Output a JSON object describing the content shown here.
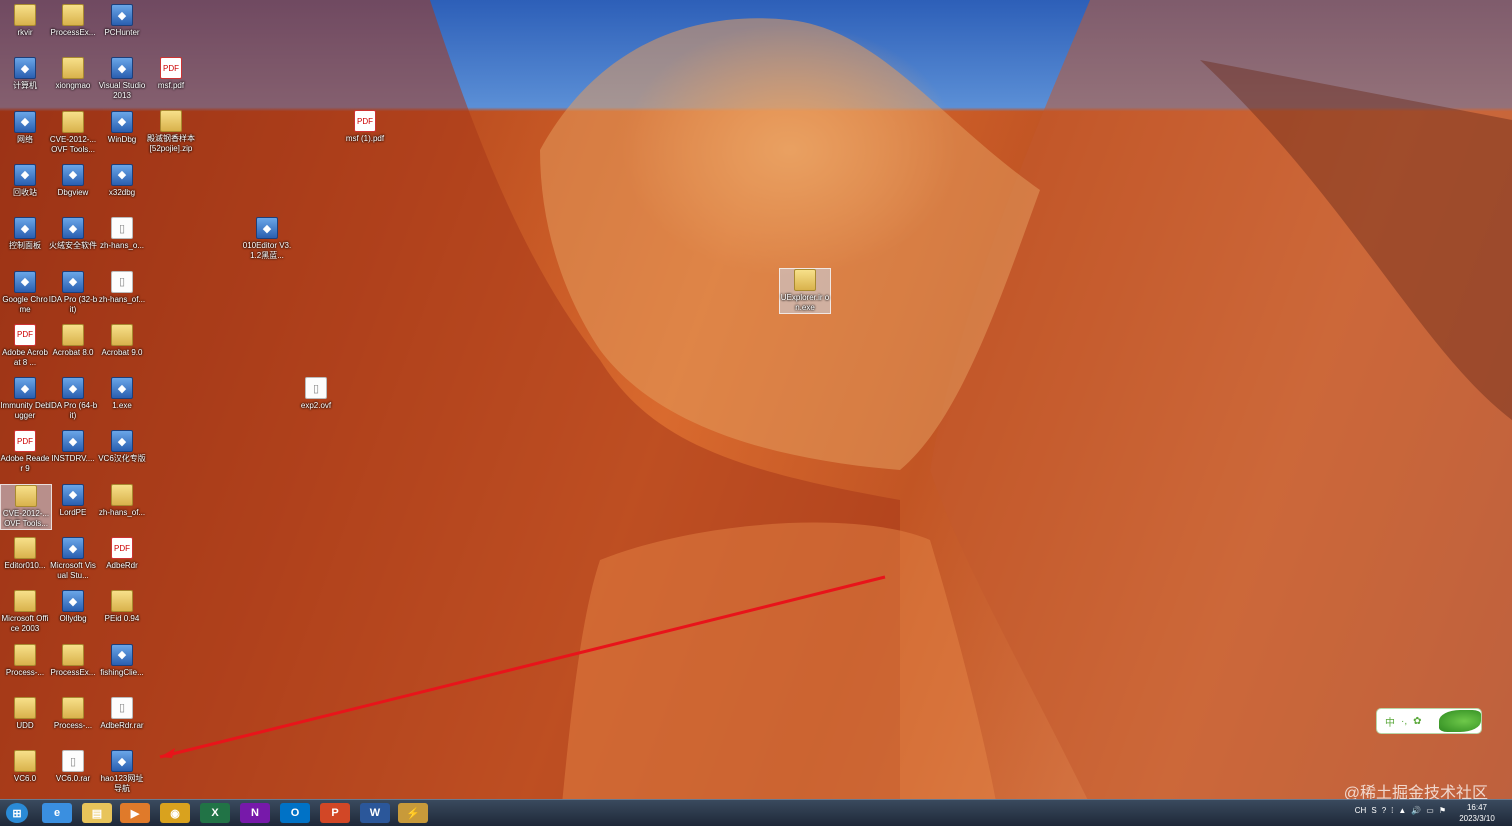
{
  "desktop": {
    "col1": [
      {
        "label": "rkvir",
        "kind": "folder"
      },
      {
        "label": "计算机",
        "kind": "app"
      },
      {
        "label": "网络",
        "kind": "app"
      },
      {
        "label": "回收站",
        "kind": "app"
      },
      {
        "label": "控制面板",
        "kind": "app"
      },
      {
        "label": "Google Chrome",
        "kind": "app"
      },
      {
        "label": "Adobe Acrobat 8 ...",
        "kind": "pdf"
      },
      {
        "label": "Immunity Debugger",
        "kind": "app"
      },
      {
        "label": "Adobe Reader 9",
        "kind": "pdf"
      },
      {
        "label": "CVE-2012-... OVF Tools...",
        "kind": "folder",
        "selected": true
      },
      {
        "label": "Editor010...",
        "kind": "folder"
      },
      {
        "label": "Microsoft Office 2003",
        "kind": "folder"
      },
      {
        "label": "Process-...",
        "kind": "folder"
      },
      {
        "label": "UDD",
        "kind": "folder"
      },
      {
        "label": "VC6.0",
        "kind": "folder"
      }
    ],
    "col2": [
      {
        "label": "ProcessEx...",
        "kind": "folder"
      },
      {
        "label": "xiongmao",
        "kind": "folder"
      },
      {
        "label": "CVE-2012-... OVF Tools...",
        "kind": "folder"
      },
      {
        "label": "Dbgview",
        "kind": "app"
      },
      {
        "label": "火绒安全软件",
        "kind": "app"
      },
      {
        "label": "IDA Pro (32-bit)",
        "kind": "app"
      },
      {
        "label": "Acrobat 8.0",
        "kind": "folder"
      },
      {
        "label": "IDA Pro (64-bit)",
        "kind": "app"
      },
      {
        "label": "INSTDRV....",
        "kind": "app"
      },
      {
        "label": "LordPE",
        "kind": "app"
      },
      {
        "label": "Microsoft Visual Stu...",
        "kind": "app"
      },
      {
        "label": "Ollydbg",
        "kind": "app"
      },
      {
        "label": "ProcessEx...",
        "kind": "folder"
      },
      {
        "label": "Process-...",
        "kind": "folder"
      },
      {
        "label": "VC6.0.rar",
        "kind": "file"
      }
    ],
    "col3": [
      {
        "label": "PCHunter",
        "kind": "app"
      },
      {
        "label": "Visual Studio 2013",
        "kind": "app"
      },
      {
        "label": "WinDbg",
        "kind": "app"
      },
      {
        "label": "x32dbg",
        "kind": "app"
      },
      {
        "label": "zh-hans_o...",
        "kind": "file"
      },
      {
        "label": "zh-hans_of...",
        "kind": "file"
      },
      {
        "label": "Acrobat 9.0",
        "kind": "folder"
      },
      {
        "label": "1.exe",
        "kind": "app"
      },
      {
        "label": "VC6汉化专版",
        "kind": "app"
      },
      {
        "label": "zh-hans_of...",
        "kind": "folder"
      },
      {
        "label": "AdbeRdr",
        "kind": "pdf"
      },
      {
        "label": "PEid 0.94",
        "kind": "folder"
      },
      {
        "label": "fishingClie...",
        "kind": "app"
      },
      {
        "label": "AdbeRdr.rar",
        "kind": "file"
      },
      {
        "label": "hao123网址导航",
        "kind": "app"
      }
    ],
    "extra": [
      {
        "label": "msf.pdf",
        "kind": "pdf",
        "id": "msf-pdf"
      },
      {
        "label": "殿滅钢香样本 [52pojie].zip",
        "kind": "folder",
        "id": "zip-sample"
      },
      {
        "label": "msf (1).pdf",
        "kind": "pdf",
        "id": "msf1-pdf"
      },
      {
        "label": "010Editor V3.1.2黑蓝...",
        "kind": "app",
        "id": "editor010"
      },
      {
        "label": "exp2.ovf",
        "kind": "file",
        "id": "exp2"
      },
      {
        "label": "UExplorer.ir on.exe",
        "kind": "folder",
        "id": "uexplorer",
        "selected": true
      }
    ]
  },
  "taskbar": {
    "buttons": [
      {
        "name": "start-button",
        "text": "⊞",
        "color": "#2a8ad6"
      },
      {
        "name": "ie-button",
        "text": "e",
        "color": "#3a8fe0"
      },
      {
        "name": "explorer-button",
        "text": "▤",
        "color": "#e8c45a"
      },
      {
        "name": "media-player-button",
        "text": "▶",
        "color": "#e07a2a"
      },
      {
        "name": "chrome-button",
        "text": "◉",
        "color": "#d9a21e"
      },
      {
        "name": "excel-button",
        "text": "X",
        "color": "#217346"
      },
      {
        "name": "onenote-button",
        "text": "N",
        "color": "#7719aa"
      },
      {
        "name": "outlook-button",
        "text": "O",
        "color": "#0072c6"
      },
      {
        "name": "powerpoint-button",
        "text": "P",
        "color": "#d24726"
      },
      {
        "name": "word-button",
        "text": "W",
        "color": "#2b579a"
      },
      {
        "name": "active-app-button",
        "text": "⚡",
        "color": "#c89a3a"
      }
    ],
    "tray": [
      "CH",
      "S",
      "?",
      "⁞",
      "▲",
      "🔊",
      "▭",
      "⚑"
    ],
    "time": "16:47",
    "date": "2023/3/10"
  },
  "ime": {
    "label1": "中",
    "label2": "·,",
    "label3": "✿"
  },
  "watermark": "@稀土掘金技术社区"
}
